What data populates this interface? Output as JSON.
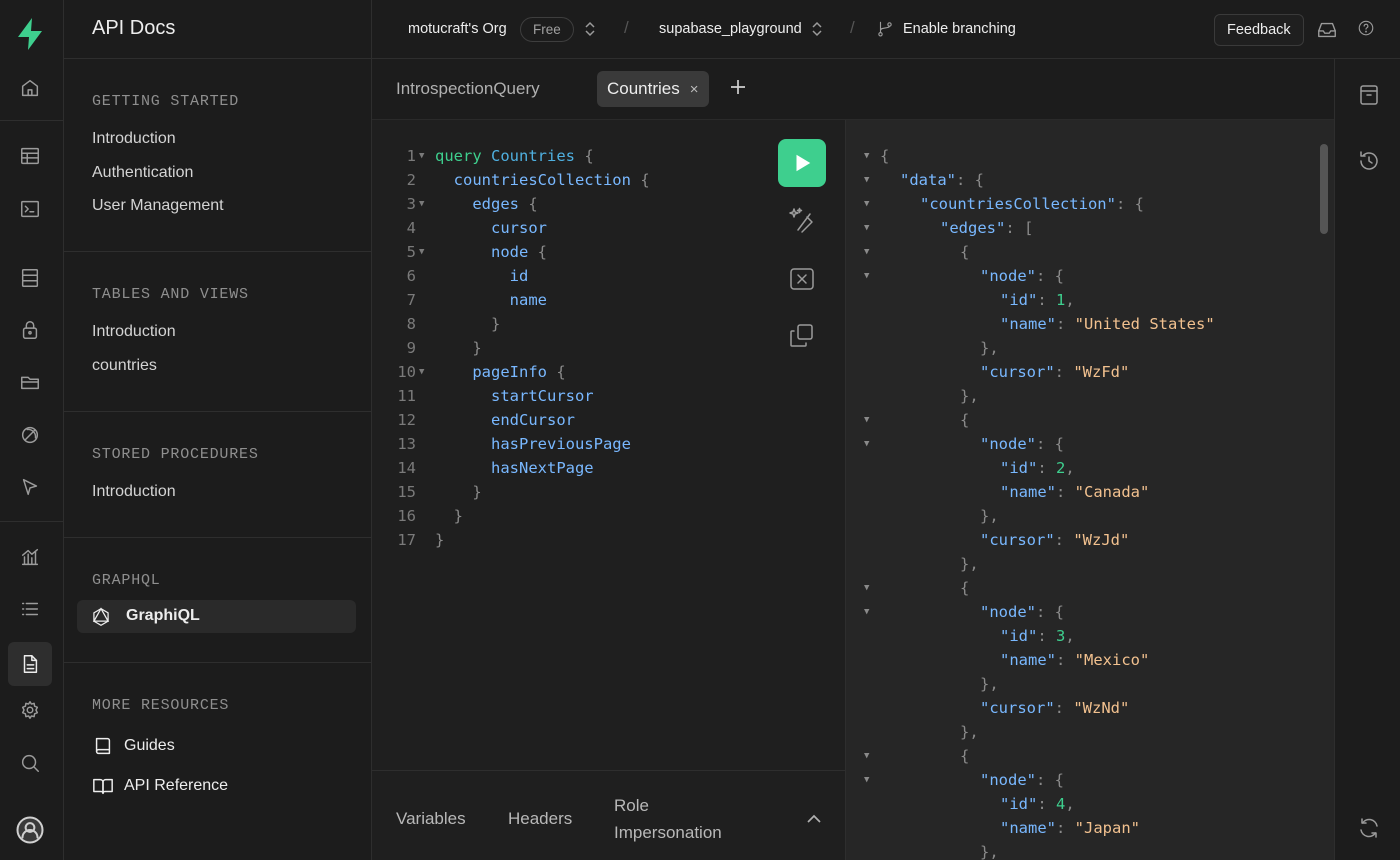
{
  "header": {
    "page_title": "API Docs",
    "org": "motucraft's Org",
    "plan_badge": "Free",
    "project": "supabase_playground",
    "branching": "Enable branching",
    "feedback": "Feedback",
    "separator": "/"
  },
  "rail": {
    "icons": [
      "home-icon",
      "table-editor-icon",
      "sql-editor-icon",
      "database-icon",
      "auth-icon",
      "storage-icon",
      "realtime-icon",
      "edge-functions-icon",
      "reports-icon",
      "logs-icon",
      "api-docs-icon",
      "settings-icon",
      "search-icon",
      "user-avatar-icon"
    ]
  },
  "docs": {
    "getting_started": {
      "title": "GETTING STARTED",
      "items": [
        "Introduction",
        "Authentication",
        "User Management"
      ]
    },
    "tables": {
      "title": "TABLES AND VIEWS",
      "items": [
        "Introduction",
        "countries"
      ]
    },
    "procedures": {
      "title": "STORED PROCEDURES",
      "items": [
        "Introduction"
      ]
    },
    "graphql": {
      "title": "GRAPHQL",
      "active_item": "GraphiQL"
    },
    "more": {
      "title": "MORE RESOURCES",
      "items": [
        "Guides",
        "API Reference"
      ]
    }
  },
  "tabs": {
    "items": [
      "IntrospectionQuery",
      "Countries"
    ],
    "active": "Countries",
    "close_glyph": "×"
  },
  "editor": {
    "lines": [
      [
        [
          "kw",
          "query "
        ],
        [
          "nm",
          "Countries "
        ],
        [
          "pn",
          "{"
        ]
      ],
      [
        [
          "fd",
          "  countriesCollection "
        ],
        [
          "pn",
          "{"
        ]
      ],
      [
        [
          "fd",
          "    edges "
        ],
        [
          "pn",
          "{"
        ]
      ],
      [
        [
          "fd",
          "      cursor"
        ]
      ],
      [
        [
          "fd",
          "      node "
        ],
        [
          "pn",
          "{"
        ]
      ],
      [
        [
          "fd",
          "        id"
        ]
      ],
      [
        [
          "fd",
          "        name"
        ]
      ],
      [
        [
          "pn",
          "      }"
        ]
      ],
      [
        [
          "pn",
          "    }"
        ]
      ],
      [
        [
          "fd",
          "    pageInfo "
        ],
        [
          "pn",
          "{"
        ]
      ],
      [
        [
          "fd",
          "      startCursor"
        ]
      ],
      [
        [
          "fd",
          "      endCursor"
        ]
      ],
      [
        [
          "fd",
          "      hasPreviousPage"
        ]
      ],
      [
        [
          "fd",
          "      hasNextPage"
        ]
      ],
      [
        [
          "pn",
          "    }"
        ]
      ],
      [
        [
          "pn",
          "  }"
        ]
      ],
      [
        [
          "pn",
          "}"
        ]
      ]
    ],
    "folds": [
      1,
      3,
      5,
      10
    ]
  },
  "variables_panel": {
    "tabs": [
      "Variables",
      "Headers",
      "Role",
      "Impersonation"
    ]
  },
  "result": {
    "lines": [
      {
        "f": 1,
        "i": 0,
        "t": [
          [
            "pn",
            "{"
          ]
        ]
      },
      {
        "f": 1,
        "i": 1,
        "t": [
          [
            "key",
            "\"data\""
          ],
          [
            "pn",
            ": {"
          ]
        ]
      },
      {
        "f": 1,
        "i": 2,
        "t": [
          [
            "key",
            "\"countriesCollection\""
          ],
          [
            "pn",
            ": {"
          ]
        ]
      },
      {
        "f": 1,
        "i": 3,
        "t": [
          [
            "key",
            "\"edges\""
          ],
          [
            "pn",
            ": ["
          ]
        ]
      },
      {
        "f": 1,
        "i": 4,
        "t": [
          [
            "pn",
            "{"
          ]
        ]
      },
      {
        "f": 1,
        "i": 5,
        "t": [
          [
            "key",
            "\"node\""
          ],
          [
            "pn",
            ": {"
          ]
        ]
      },
      {
        "f": 0,
        "i": 6,
        "t": [
          [
            "key",
            "\"id\""
          ],
          [
            "pn",
            ": "
          ],
          [
            "num",
            "1"
          ],
          [
            "pn",
            ","
          ]
        ]
      },
      {
        "f": 0,
        "i": 6,
        "t": [
          [
            "key",
            "\"name\""
          ],
          [
            "pn",
            ": "
          ],
          [
            "str",
            "\"United States\""
          ]
        ]
      },
      {
        "f": 0,
        "i": 5,
        "t": [
          [
            "pn",
            "},"
          ]
        ]
      },
      {
        "f": 0,
        "i": 5,
        "t": [
          [
            "key",
            "\"cursor\""
          ],
          [
            "pn",
            ": "
          ],
          [
            "str",
            "\"WzFd\""
          ]
        ]
      },
      {
        "f": 0,
        "i": 4,
        "t": [
          [
            "pn",
            "},"
          ]
        ]
      },
      {
        "f": 1,
        "i": 4,
        "t": [
          [
            "pn",
            "{"
          ]
        ]
      },
      {
        "f": 1,
        "i": 5,
        "t": [
          [
            "key",
            "\"node\""
          ],
          [
            "pn",
            ": {"
          ]
        ]
      },
      {
        "f": 0,
        "i": 6,
        "t": [
          [
            "key",
            "\"id\""
          ],
          [
            "pn",
            ": "
          ],
          [
            "num",
            "2"
          ],
          [
            "pn",
            ","
          ]
        ]
      },
      {
        "f": 0,
        "i": 6,
        "t": [
          [
            "key",
            "\"name\""
          ],
          [
            "pn",
            ": "
          ],
          [
            "str",
            "\"Canada\""
          ]
        ]
      },
      {
        "f": 0,
        "i": 5,
        "t": [
          [
            "pn",
            "},"
          ]
        ]
      },
      {
        "f": 0,
        "i": 5,
        "t": [
          [
            "key",
            "\"cursor\""
          ],
          [
            "pn",
            ": "
          ],
          [
            "str",
            "\"WzJd\""
          ]
        ]
      },
      {
        "f": 0,
        "i": 4,
        "t": [
          [
            "pn",
            "},"
          ]
        ]
      },
      {
        "f": 1,
        "i": 4,
        "t": [
          [
            "pn",
            "{"
          ]
        ]
      },
      {
        "f": 1,
        "i": 5,
        "t": [
          [
            "key",
            "\"node\""
          ],
          [
            "pn",
            ": {"
          ]
        ]
      },
      {
        "f": 0,
        "i": 6,
        "t": [
          [
            "key",
            "\"id\""
          ],
          [
            "pn",
            ": "
          ],
          [
            "num",
            "3"
          ],
          [
            "pn",
            ","
          ]
        ]
      },
      {
        "f": 0,
        "i": 6,
        "t": [
          [
            "key",
            "\"name\""
          ],
          [
            "pn",
            ": "
          ],
          [
            "str",
            "\"Mexico\""
          ]
        ]
      },
      {
        "f": 0,
        "i": 5,
        "t": [
          [
            "pn",
            "},"
          ]
        ]
      },
      {
        "f": 0,
        "i": 5,
        "t": [
          [
            "key",
            "\"cursor\""
          ],
          [
            "pn",
            ": "
          ],
          [
            "str",
            "\"WzNd\""
          ]
        ]
      },
      {
        "f": 0,
        "i": 4,
        "t": [
          [
            "pn",
            "},"
          ]
        ]
      },
      {
        "f": 1,
        "i": 4,
        "t": [
          [
            "pn",
            "{"
          ]
        ]
      },
      {
        "f": 1,
        "i": 5,
        "t": [
          [
            "key",
            "\"node\""
          ],
          [
            "pn",
            ": {"
          ]
        ]
      },
      {
        "f": 0,
        "i": 6,
        "t": [
          [
            "key",
            "\"id\""
          ],
          [
            "pn",
            ": "
          ],
          [
            "num",
            "4"
          ],
          [
            "pn",
            ","
          ]
        ]
      },
      {
        "f": 0,
        "i": 6,
        "t": [
          [
            "key",
            "\"name\""
          ],
          [
            "pn",
            ": "
          ],
          [
            "str",
            "\"Japan\""
          ]
        ]
      },
      {
        "f": 0,
        "i": 5,
        "t": [
          [
            "pn",
            "},"
          ]
        ]
      }
    ]
  },
  "right_rail": {
    "icons": [
      "archive-icon",
      "history-icon",
      "refresh-icon"
    ]
  },
  "colors": {
    "accent": "#3ecf8e",
    "background": "#1c1c1c",
    "editor_bg": "#1f1f1f",
    "result_bg": "#262626"
  }
}
